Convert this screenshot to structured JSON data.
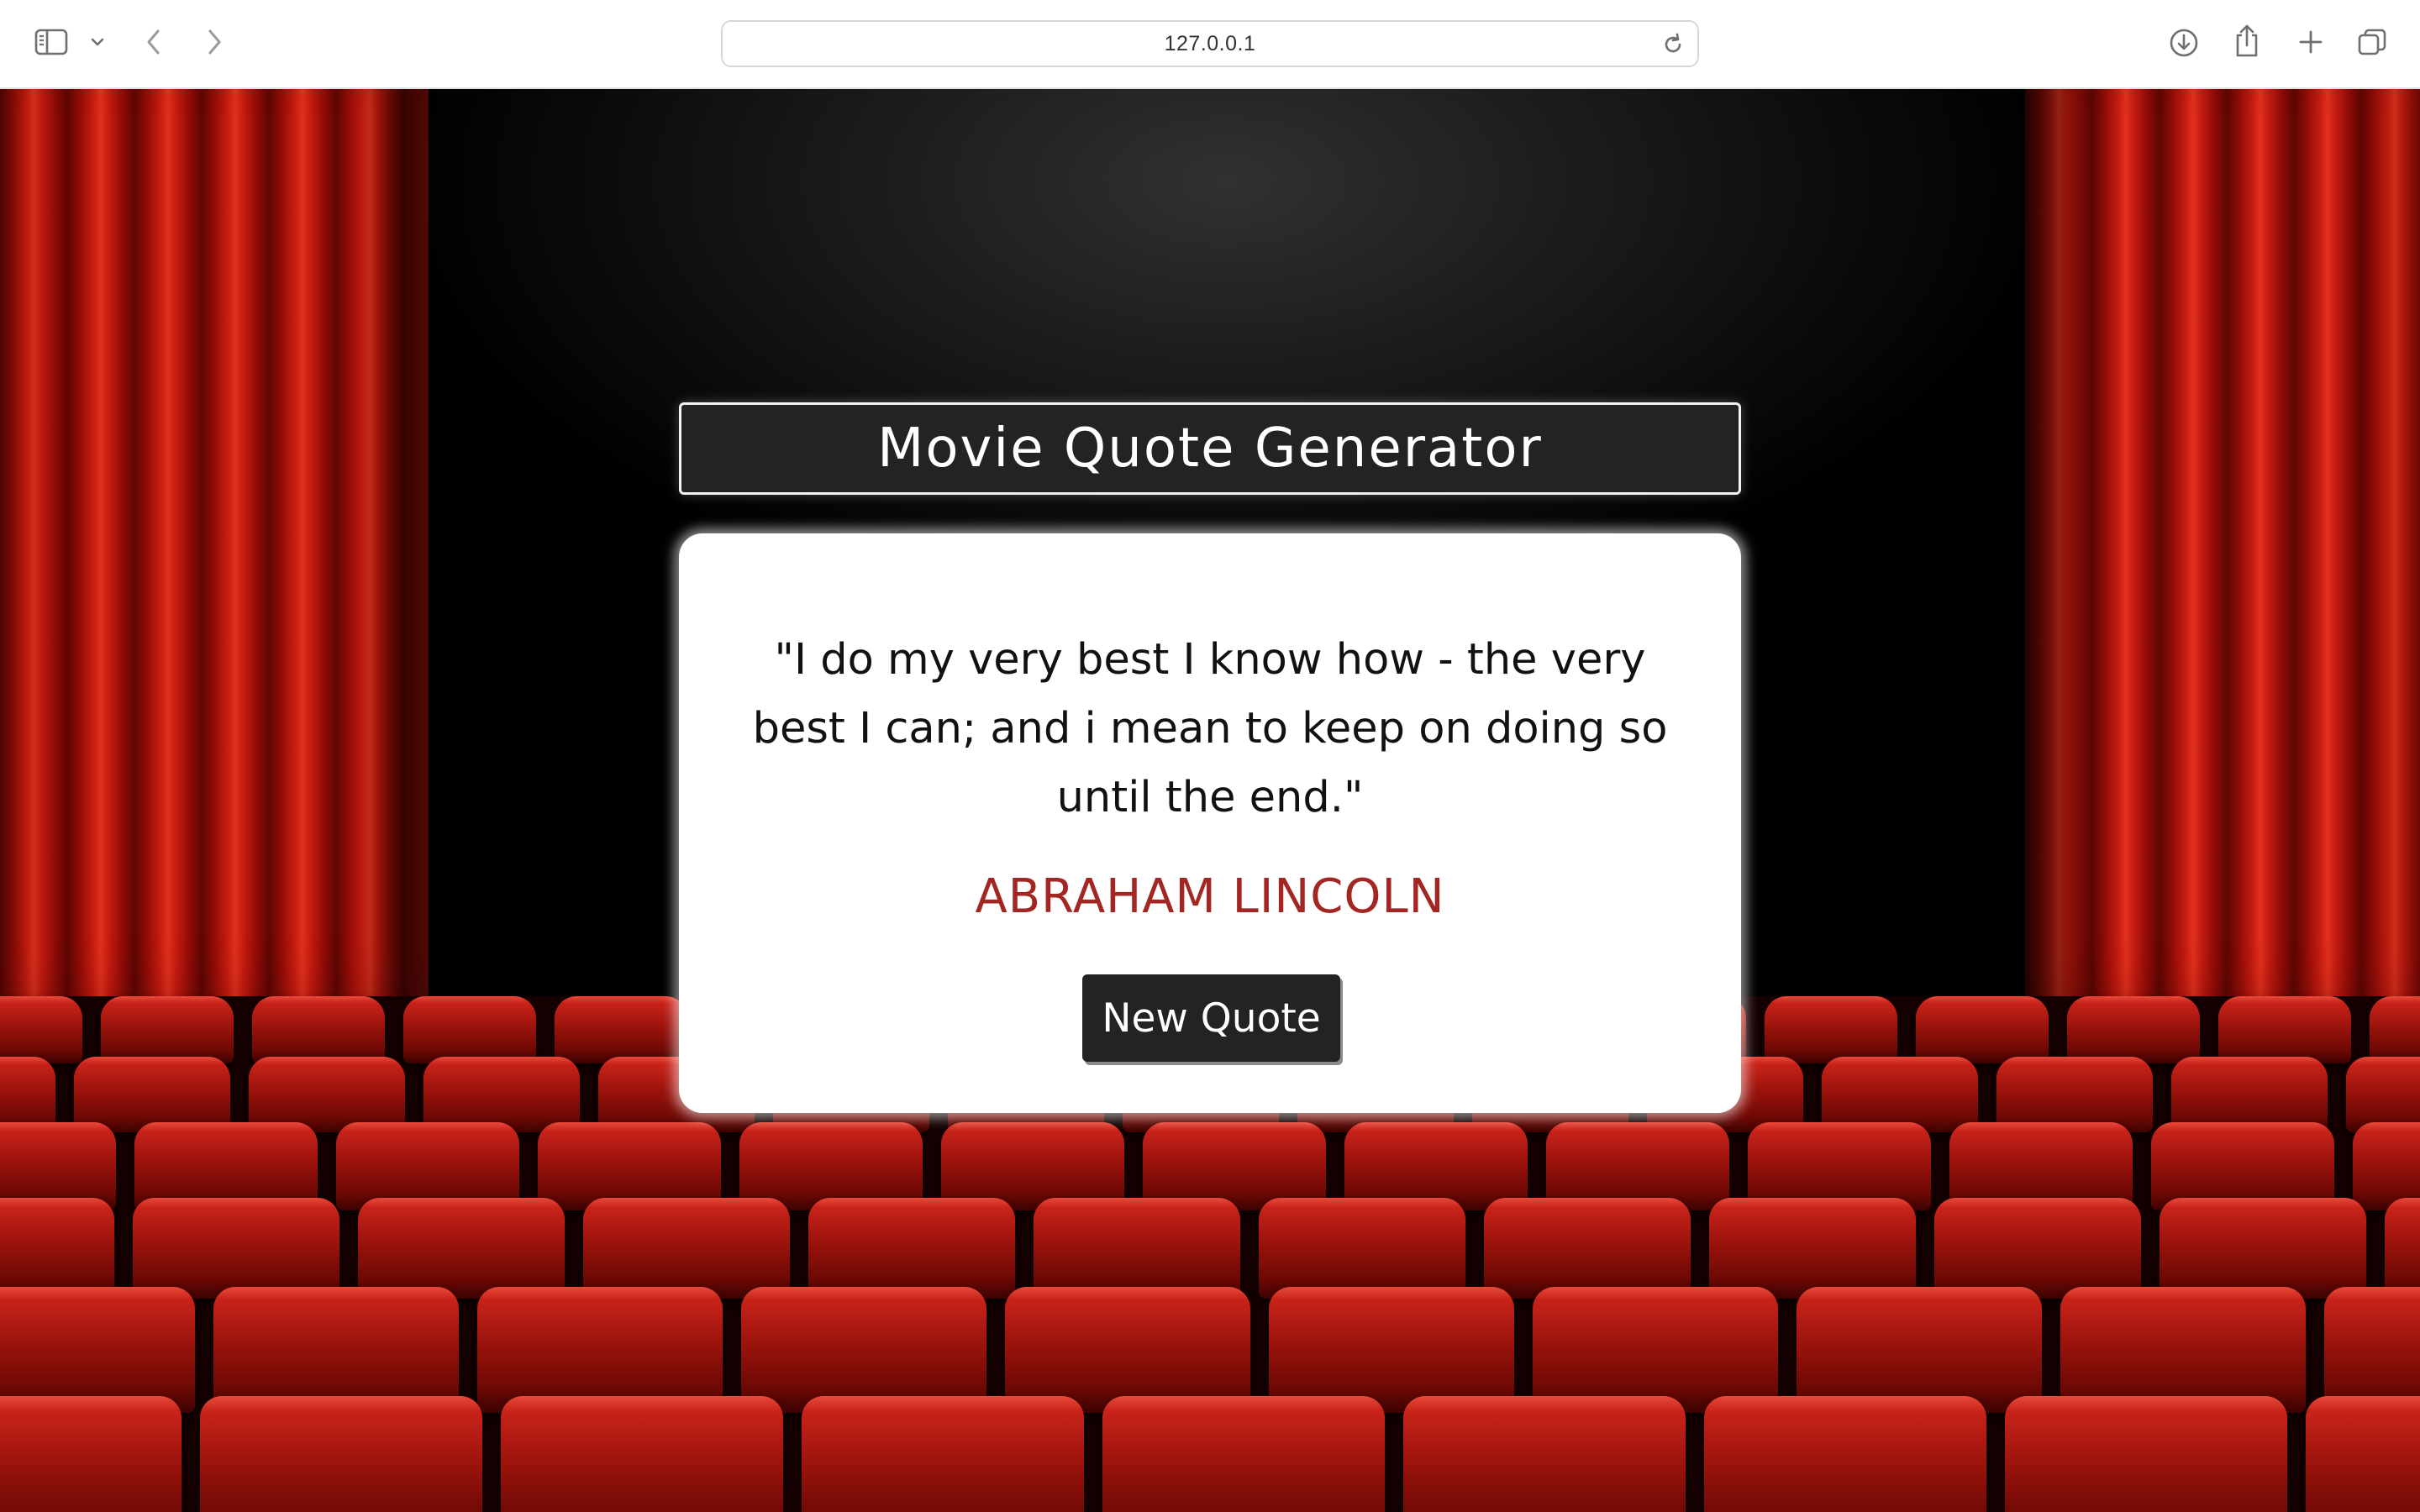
{
  "browser": {
    "url": "127.0.0.1",
    "icons": {
      "sidebar": "sidebar-icon",
      "sidebar_menu": "chevron-down-icon",
      "back": "chevron-left-icon",
      "forward": "chevron-right-icon",
      "reload": "reload-icon",
      "downloads": "download-icon",
      "share": "share-icon",
      "new_tab": "plus-icon",
      "tab_overview": "tabs-icon"
    }
  },
  "app": {
    "title": "Movie Quote Generator",
    "quote": "\"I do my very best I know how - the very best I can; and i mean to keep on doing so until the end.\"",
    "author": "ABRAHAM LINCOLN",
    "button_label": "New Quote"
  },
  "colors": {
    "title_bg": "#232323",
    "author": "#a32622",
    "card_bg": "#ffffff",
    "curtain": "#c41b10",
    "seat": "#9b130c"
  }
}
